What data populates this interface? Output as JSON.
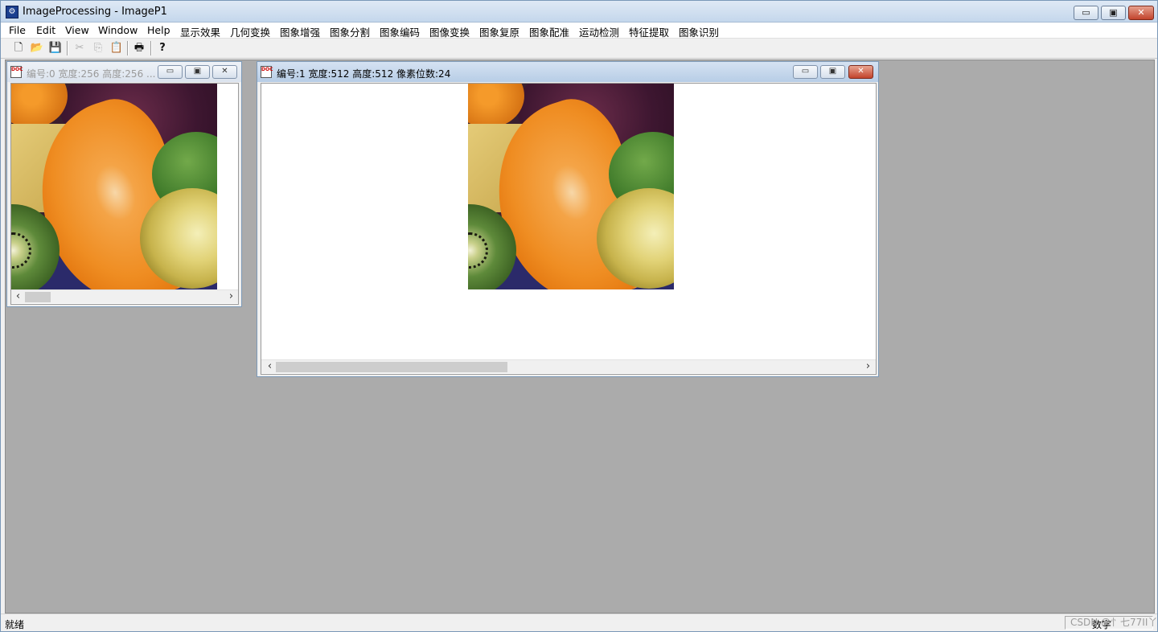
{
  "app": {
    "title": "ImageProcessing - ImageP1",
    "icon_glyph": "⚙",
    "caption_buttons": {
      "minimize": "▭",
      "restore": "▣",
      "close": "✕"
    }
  },
  "menu": {
    "items": [
      "File",
      "Edit",
      "View",
      "Window",
      "Help",
      "显示效果",
      "几何变换",
      "图象增强",
      "图象分割",
      "图象编码",
      "图像变换",
      "图象复原",
      "图象配准",
      "运动检测",
      "特征提取",
      "图象识别"
    ]
  },
  "toolbar": {
    "buttons": [
      {
        "name": "new-file-icon",
        "glyph": "🗋",
        "enabled": true
      },
      {
        "name": "open-folder-icon",
        "glyph": "📂",
        "enabled": true
      },
      {
        "name": "save-icon",
        "glyph": "💾",
        "enabled": true
      },
      {
        "name": "cut-icon",
        "glyph": "✂",
        "enabled": false
      },
      {
        "name": "copy-icon",
        "glyph": "⎘",
        "enabled": false
      },
      {
        "name": "paste-icon",
        "glyph": "📋",
        "enabled": false
      },
      {
        "name": "print-icon",
        "glyph": "🖶",
        "enabled": true
      },
      {
        "name": "help-icon",
        "glyph": "?",
        "enabled": true
      }
    ]
  },
  "windows": {
    "doc0": {
      "title": "编号:0 宽度:256 高度:256 ...",
      "icon_text": "DOC",
      "active": false
    },
    "doc1": {
      "title": "编号:1 宽度:512 高度:512 像素位数:24",
      "icon_text": "DOC",
      "active": true
    }
  },
  "scroll": {
    "left_arrow": "‹",
    "right_arrow": "›"
  },
  "status": {
    "text": "就绪",
    "num_indicator": "数字",
    "watermark": "CSDN @忄七77II丫"
  },
  "colors": {
    "mdi_background": "#ababab",
    "titlebar": "#c4d7ec"
  }
}
